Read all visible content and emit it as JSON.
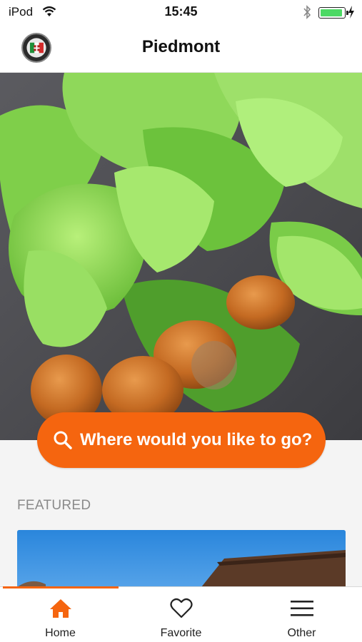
{
  "status_bar": {
    "carrier": "iPod",
    "time": "15:45",
    "battery_color": "#4cd964"
  },
  "nav": {
    "title": "Piedmont",
    "logo_icon": "region-crest-icon"
  },
  "hero": {
    "image": "hazelnuts-with-green-husks"
  },
  "search": {
    "label": "Where would you like to go?",
    "icon": "search-icon",
    "color": "#f5650f"
  },
  "featured": {
    "heading": "FEATURED",
    "card_image": "blue-sky-rooftop"
  },
  "tabbar": {
    "accent": "#f5650f",
    "tabs": [
      {
        "label": "Home",
        "icon": "home-icon",
        "active": true
      },
      {
        "label": "Favorite",
        "icon": "heart-icon",
        "active": false
      },
      {
        "label": "Other",
        "icon": "menu-icon",
        "active": false
      }
    ]
  }
}
